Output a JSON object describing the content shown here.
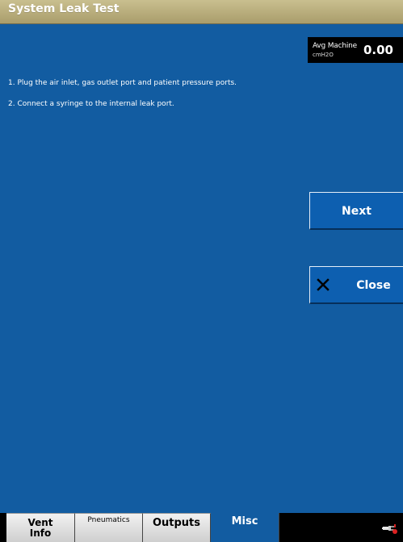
{
  "header": {
    "title": "System Leak Test"
  },
  "metric": {
    "label": "Avg Machine",
    "unit": "cmH2O",
    "value": "0.00"
  },
  "instructions": [
    "1. Plug the air inlet, gas outlet port and patient pressure ports.",
    "2. Connect a syringe to the internal leak port."
  ],
  "buttons": {
    "next": "Next",
    "close": "Close"
  },
  "tabs": [
    {
      "line1": "Vent",
      "line2": "Info"
    },
    {
      "label": "Pneumatics"
    },
    {
      "label": "Outputs"
    },
    {
      "label": "Misc",
      "active": true
    }
  ],
  "colors": {
    "background": "#125ca1",
    "titlebar": "#b5aa78",
    "tabbar": "#000000"
  },
  "icons": {
    "close": "close-x-icon",
    "status": "power-plug-icon"
  }
}
